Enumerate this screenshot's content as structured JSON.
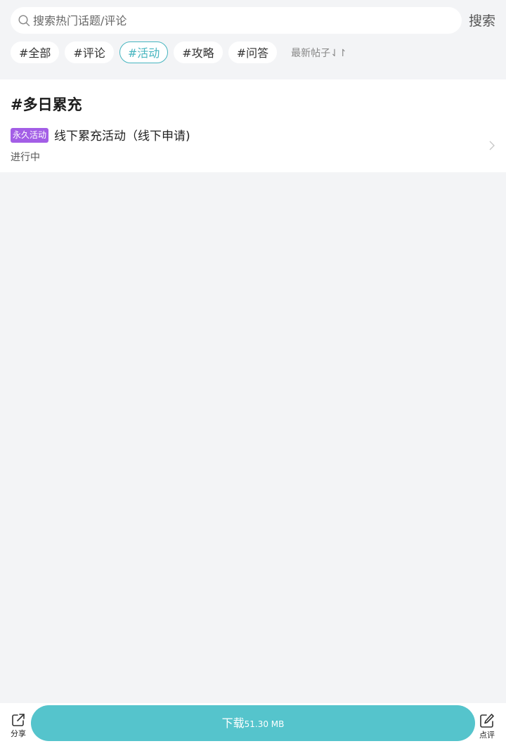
{
  "search": {
    "placeholder": "搜索热门话题/评论",
    "button_label": "搜索"
  },
  "tags": [
    {
      "label": "#全部",
      "active": false
    },
    {
      "label": "#评论",
      "active": false
    },
    {
      "label": "#活动",
      "active": true
    },
    {
      "label": "#攻略",
      "active": false
    },
    {
      "label": "#问答",
      "active": false
    }
  ],
  "sort_label": "最新帖子⇃↾",
  "topic": {
    "title": "#多日累充",
    "items": [
      {
        "badge": "永久活动",
        "title": "线下累充活动（线下申请)",
        "status": "进行中"
      }
    ]
  },
  "bottom_bar": {
    "share_label": "分享",
    "download_label": "下载",
    "download_size": "51.30 MB",
    "comment_label": "点评"
  },
  "colors": {
    "accent": "#46b5bf",
    "download_bg": "#55c4cc",
    "badge_bg": "#a35ee6",
    "page_bg": "#f3f4f6"
  }
}
